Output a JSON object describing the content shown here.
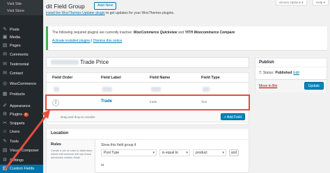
{
  "sidebar": {
    "submenu": [
      "Visit Site",
      "Visit Store"
    ],
    "items": [
      {
        "icon": "pin-icon",
        "glyph": "✎",
        "label": "Posts"
      },
      {
        "icon": "media-icon",
        "glyph": "▣",
        "label": "Media"
      },
      {
        "icon": "pages-icon",
        "glyph": "▤",
        "label": "Pages"
      },
      {
        "icon": "comments-icon",
        "glyph": "✉",
        "label": "Comments"
      },
      {
        "icon": "testimonial-icon",
        "glyph": "✉",
        "label": "Testimonial"
      },
      {
        "icon": "contact-icon",
        "glyph": "✉",
        "label": "Contact"
      },
      {
        "icon": "woocommerce-icon",
        "glyph": "◎",
        "label": "WooCommerce"
      },
      {
        "icon": "products-icon",
        "glyph": "▦",
        "label": "Products"
      },
      {
        "icon": "appearance-icon",
        "glyph": "✐",
        "label": "Appearance"
      },
      {
        "icon": "plugins-icon",
        "glyph": "⚙",
        "label": "Plugins",
        "badge": "8"
      },
      {
        "icon": "snippets-icon",
        "glyph": "✂",
        "label": "Snippets"
      },
      {
        "icon": "users-icon",
        "glyph": "☺",
        "label": "Users"
      },
      {
        "icon": "tools-icon",
        "glyph": "✎",
        "label": "Tools"
      },
      {
        "icon": "visual-composer-icon",
        "glyph": "▤",
        "label": "Visual Composer"
      },
      {
        "icon": "settings-icon",
        "glyph": "⚙",
        "label": "Settings"
      },
      {
        "icon": "custom-fields-icon",
        "glyph": "▤",
        "label": "Custom Fields"
      }
    ]
  },
  "header": {
    "title": "dit Field Group",
    "add_new": "Add New",
    "screen_options": "Screen Options ▾",
    "help": "Help ▾"
  },
  "notice_updater": {
    "link": "install the WooThemes Updater plugin",
    "rest": " to get updates for your WooThemes plugins."
  },
  "notice_required": {
    "prefix": "The following required plugins are currently inactive: ",
    "plugin1": "WooCommerce Quickview",
    "and": " and ",
    "plugin2": "YITH Woocommerce Compare",
    "link1": "Activate installed plugins",
    "sep": " | ",
    "link2": "Dismiss this notice"
  },
  "field_group": {
    "title": "Trade Price",
    "headers": [
      "Field Order",
      "Field Label",
      "Field Name",
      "Field Type"
    ],
    "row": {
      "order": "2",
      "label": "Trade",
      "name": "trade",
      "type": "Text"
    },
    "drag_text": "Drag and drop to reorder",
    "add_field": "+ Add Field"
  },
  "location": {
    "title": "Location",
    "rules_title": "Rules",
    "rules_desc": "Create a set of rules to determine which edit screens will use these advanced custom fields",
    "show_if": "Show this field group if",
    "param": "Post Type",
    "operator": "is equal to",
    "value": "product",
    "and": "and",
    "or": "or"
  },
  "publish": {
    "title": "Publish",
    "status_label": "Status:",
    "status_value": "Published",
    "edit": "Edit",
    "move_trash": "Move to Bin",
    "update": "Update"
  },
  "colors": {
    "sidebar": "#23282d",
    "active": "#0073aa",
    "highlight": "#e74c3c",
    "notice_border": "#46b450"
  }
}
